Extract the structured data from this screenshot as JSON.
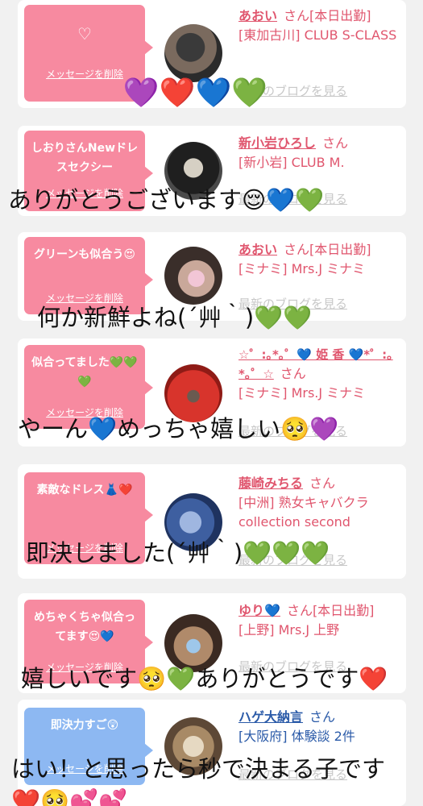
{
  "cards": [
    {
      "bubble_text": "",
      "bubble_icon": "♡",
      "delete_label": "メッセージを削除",
      "name": "あおい",
      "suffix": "さん[本日出勤]",
      "shop": "[東加古川] CLUB S-CLASS",
      "blog_label": "最新のブログを見る",
      "caption": "💜❤️💙💚"
    },
    {
      "bubble_text": "しおりさんNewドレスセクシー",
      "delete_label": "メッセージを削除",
      "name": "新小岩ひろし",
      "suffix": "さん",
      "shop": "[新小岩] CLUB M.",
      "blog_label": "最新のブログを見る",
      "caption": "ありがとうございます😌💙💚"
    },
    {
      "bubble_text": "グリーンも似合う😍",
      "delete_label": "メッセージを削除",
      "name": "あおい",
      "suffix": "さん[本日出勤]",
      "shop": "[ミナミ] Mrs.J ミナミ",
      "blog_label": "最新のブログを見る",
      "caption": "何か新鮮よね(´艸｀)💚💚"
    },
    {
      "bubble_text": "似合ってました💚💚💚",
      "delete_label": "メッセージを削除",
      "name": "☆゜:｡*｡゜💙 姫 香 💙*゜:｡*｡゜☆",
      "suffix": "さん",
      "shop": "[ミナミ] Mrs.J ミナミ",
      "blog_label": "最新のブログを見る",
      "caption": "やーん💙めっちゃ嬉しい🥺💜"
    },
    {
      "bubble_text": "素敵なドレス👗❤️",
      "delete_label": "メッセージを削除",
      "name": "藤崎みちる",
      "suffix": "さん",
      "shop": "[中洲] 熟女キャバクラ collection second",
      "blog_label": "最新のブログを見る",
      "caption": "即決しました(´艸｀)💚💚💚"
    },
    {
      "bubble_text": "めちゃくちゃ似合ってます😍💙",
      "delete_label": "メッセージを削除",
      "name": "ゆり💙",
      "suffix": "さん[本日出勤]",
      "shop": "[上野] Mrs.J 上野",
      "blog_label": "最新のブログを見る",
      "caption": "嬉しいです🥺💚ありがとうです❤️"
    },
    {
      "bubble_text": "即決力すご😲",
      "delete_label": "メッセージを削除",
      "name": "ハゲ大納言",
      "suffix": "さん",
      "shop": "[大阪府] 体験談 2件",
      "blog_label": "最新のブログを見る",
      "caption": "はい！と思ったら秒で決まる子です❤️🥺💕💕"
    }
  ],
  "colors": {
    "pink_bubble": "#f78aa0",
    "blue_bubble": "#8db8f2",
    "name_pink": "#e0566e",
    "name_blue": "#2a5aa8",
    "background": "#f1f1f1"
  },
  "icons": [
    "heart-outline-icon"
  ]
}
